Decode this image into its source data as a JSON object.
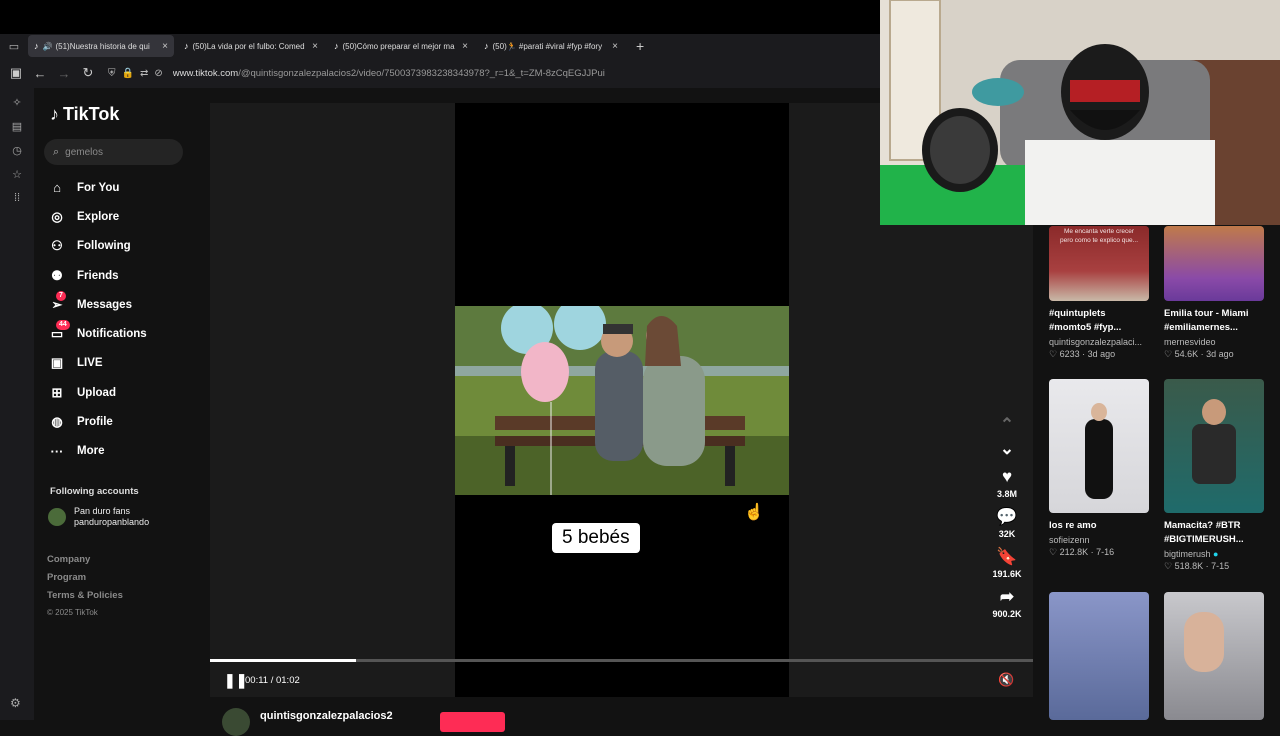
{
  "tabs": [
    {
      "label": "(51)Nuestra historia de qui",
      "active": true
    },
    {
      "label": "(50)La vida por el fulbo: Comed",
      "active": false
    },
    {
      "label": "(50)Cómo preparar el mejor ma",
      "active": false
    },
    {
      "label": "(50)🏃 #parati #viral #fyp #fory",
      "active": false
    }
  ],
  "address": {
    "host": "www.tiktok.com",
    "path": "/@quintisgonzalezpalacios2/video/7500373983238343978?_r=1&_t=ZM-8zCqEGJJPui"
  },
  "brand": "TikTok",
  "search": {
    "value": "gemelos"
  },
  "nav": [
    {
      "label": "For You",
      "icon": "home-icon"
    },
    {
      "label": "Explore",
      "icon": "compass-icon"
    },
    {
      "label": "Following",
      "icon": "user-follow-icon"
    },
    {
      "label": "Friends",
      "icon": "friends-icon"
    },
    {
      "label": "Messages",
      "icon": "paper-plane-icon",
      "badge": "7"
    },
    {
      "label": "Notifications",
      "icon": "inbox-icon",
      "badge": "44"
    },
    {
      "label": "LIVE",
      "icon": "tv-icon"
    },
    {
      "label": "Upload",
      "icon": "plus-square-icon"
    },
    {
      "label": "Profile",
      "icon": "avatar-icon"
    },
    {
      "label": "More",
      "icon": "more-dots-icon"
    }
  ],
  "following": {
    "title": "Following accounts",
    "accounts": [
      {
        "name": "Pan duro fans",
        "handle": "panduropanblando"
      }
    ]
  },
  "footer": {
    "links": [
      "Company",
      "Program",
      "Terms & Policies"
    ],
    "copyright": "© 2025 TikTok"
  },
  "video": {
    "caption": "5 bebés",
    "time": "00:11 / 01:02",
    "progress": 0.178
  },
  "actions": [
    {
      "icon": "heart-icon",
      "count": "3.8M"
    },
    {
      "icon": "comment-icon",
      "count": "32K"
    },
    {
      "icon": "bookmark-icon",
      "count": "191.6K"
    },
    {
      "icon": "share-icon",
      "count": "900.2K"
    }
  ],
  "author": {
    "name": "quintisgonzalezpalacios2"
  },
  "recommendations": [
    {
      "title1": "#quintuplets",
      "title2": "#momto5 #fyp...",
      "author": "quintisgonzalezpalaci...",
      "stats": "♡ 6233 · 3d ago",
      "overlay": "Me encanta verte crecer pero como te explico que..."
    },
    {
      "title1": "Emilia tour - Miami",
      "title2": "#emiliamernes...",
      "author": "mernesvideo",
      "stats": "♡ 54.6K · 3d ago",
      "overlay": ""
    },
    {
      "title1": "los re amo",
      "title2": "",
      "author": "sofieizenn",
      "stats": "♡ 212.8K · 7-16",
      "overlay": ""
    },
    {
      "title1": "Mamacita? #BTR",
      "title2": "#BIGTIMERUSH...",
      "author": "bigtimerush",
      "stats": "♡ 518.8K · 7-15",
      "overlay": ""
    }
  ]
}
